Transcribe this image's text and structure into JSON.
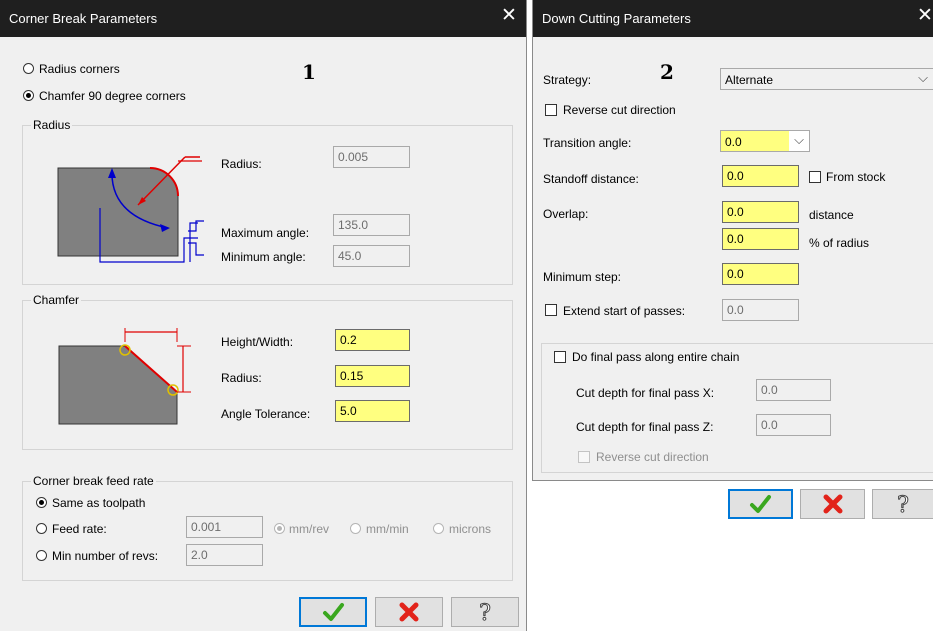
{
  "left_dialog": {
    "title": "Corner Break Parameters",
    "marker": "1",
    "mode_options": [
      "Radius corners",
      "Chamfer 90 degree corners"
    ],
    "radius_group": {
      "title": "Radius",
      "radius_label": "Radius:",
      "radius_value": "0.005",
      "max_angle_label": "Maximum angle:",
      "max_angle_value": "135.0",
      "min_angle_label": "Minimum angle:",
      "min_angle_value": "45.0"
    },
    "chamfer_group": {
      "title": "Chamfer",
      "hw_label": "Height/Width:",
      "hw_value": "0.2",
      "radius_label": "Radius:",
      "radius_value": "0.15",
      "tol_label": "Angle Tolerance:",
      "tol_value": "5.0"
    },
    "feed_group": {
      "title": "Corner break feed rate",
      "same_label": "Same as toolpath",
      "feed_label": "Feed rate:",
      "feed_value": "0.001",
      "units": [
        "mm/rev",
        "mm/min",
        "microns"
      ],
      "revs_label": "Min number of revs:",
      "revs_value": "2.0"
    }
  },
  "right_dialog": {
    "title": "Down Cutting Parameters",
    "marker": "2",
    "strategy_label": "Strategy:",
    "strategy_value": "Alternate",
    "reverse_label": "Reverse cut direction",
    "transition_label": "Transition angle:",
    "transition_value": "0.0",
    "standoff_label": "Standoff distance:",
    "standoff_value": "0.0",
    "from_stock_label": "From stock",
    "overlap_label": "Overlap:",
    "overlap_distance": "0.0",
    "overlap_distance_unit": "distance",
    "overlap_percent": "0.0",
    "overlap_percent_unit": "% of radius",
    "min_step_label": "Minimum step:",
    "min_step_value": "0.0",
    "extend_label": "Extend start of passes:",
    "extend_value": "0.0",
    "final_pass_label": "Do final pass along entire chain",
    "final_x_label": "Cut depth for final pass X:",
    "final_x_value": "0.0",
    "final_z_label": "Cut depth for final pass Z:",
    "final_z_value": "0.0",
    "final_reverse_label": "Reverse cut direction"
  },
  "icons": {
    "close": "close-icon",
    "ok": "checkmark-icon",
    "cancel": "x-icon",
    "help": "question-icon",
    "colors": {
      "ok": "#3aa71f",
      "cancel": "#e2231a",
      "highlight": "#ffff80",
      "accent": "#0078d7"
    }
  }
}
